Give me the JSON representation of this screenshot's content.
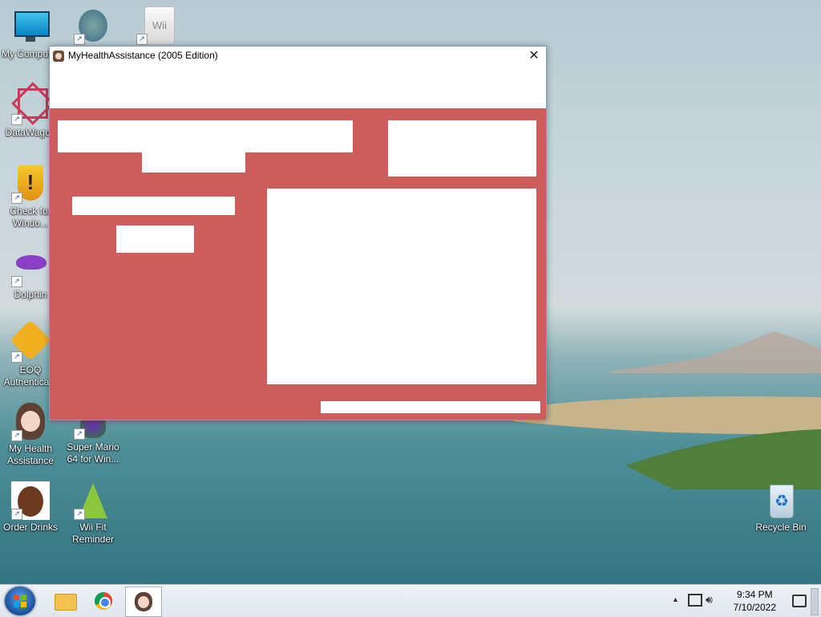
{
  "desktop": {
    "icons": [
      {
        "label": "My Computer"
      },
      {
        "label": ""
      },
      {
        "label": ""
      },
      {
        "label": "DataWagon"
      },
      {
        "label": "Check for Windo..."
      },
      {
        "label": "Dolphin"
      },
      {
        "label": "EOQ Authentica..."
      },
      {
        "label": "My Health Assistance"
      },
      {
        "label": "Super Mario 64 for Win..."
      },
      {
        "label": "Order Drinks"
      },
      {
        "label": "Wii Fit Reminder"
      },
      {
        "label": "Recycle Bin"
      }
    ],
    "wii_badge": "Wii"
  },
  "window": {
    "title": "MyHealthAssistance (2005 Edition)",
    "close_glyph": "✕",
    "client_color": "#cd5c5c"
  },
  "taskbar": {
    "time": "9:34 PM",
    "date": "7/10/2022",
    "tray_chevron": "▲"
  }
}
